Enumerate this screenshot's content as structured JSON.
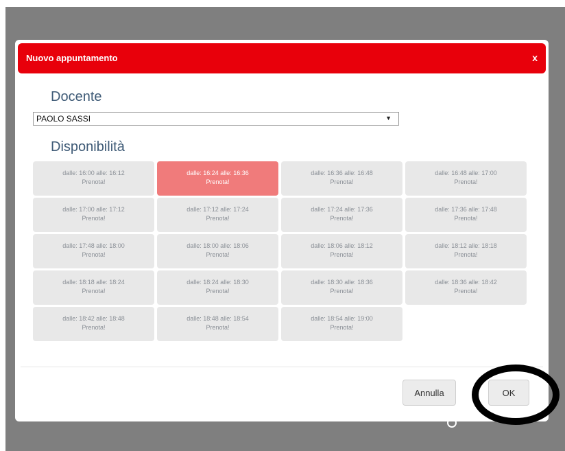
{
  "modal": {
    "title": "Nuovo appuntamento",
    "close_label": "x"
  },
  "docente": {
    "label": "Docente",
    "selected": "PAOLO SASSI"
  },
  "disponibilita": {
    "label": "Disponibilità",
    "slots": [
      {
        "range": "dalle: 16:00 alle: 16:12",
        "action": "Prenota!"
      },
      {
        "range": "dalle: 16:24 alle: 16:36",
        "action": "Prenota!",
        "selected": true
      },
      {
        "range": "dalle: 16:36 alle: 16:48",
        "action": "Prenota!"
      },
      {
        "range": "dalle: 16:48 alle: 17:00",
        "action": "Prenota!"
      },
      {
        "range": "dalle: 17:00 alle: 17:12",
        "action": "Prenota!"
      },
      {
        "range": "dalle: 17:12 alle: 17:24",
        "action": "Prenota!"
      },
      {
        "range": "dalle: 17:24 alle: 17:36",
        "action": "Prenota!"
      },
      {
        "range": "dalle: 17:36 alle: 17:48",
        "action": "Prenota!"
      },
      {
        "range": "dalle: 17:48 alle: 18:00",
        "action": "Prenota!"
      },
      {
        "range": "dalle: 18:00 alle: 18:06",
        "action": "Prenota!"
      },
      {
        "range": "dalle: 18:06 alle: 18:12",
        "action": "Prenota!"
      },
      {
        "range": "dalle: 18:12 alle: 18:18",
        "action": "Prenota!"
      },
      {
        "range": "dalle: 18:18 alle: 18:24",
        "action": "Prenota!"
      },
      {
        "range": "dalle: 18:24 alle: 18:30",
        "action": "Prenota!"
      },
      {
        "range": "dalle: 18:30 alle: 18:36",
        "action": "Prenota!"
      },
      {
        "range": "dalle: 18:36 alle: 18:42",
        "action": "Prenota!"
      },
      {
        "range": "dalle: 18:42 alle: 18:48",
        "action": "Prenota!"
      },
      {
        "range": "dalle: 18:48 alle: 18:54",
        "action": "Prenota!"
      },
      {
        "range": "dalle: 18:54 alle: 19:00",
        "action": "Prenota!"
      }
    ]
  },
  "footer": {
    "cancel_label": "Annulla",
    "ok_label": "OK"
  },
  "colors": {
    "header": "#e8000b",
    "selected_slot": "#f07b7b",
    "slot": "#e8e8e8"
  }
}
